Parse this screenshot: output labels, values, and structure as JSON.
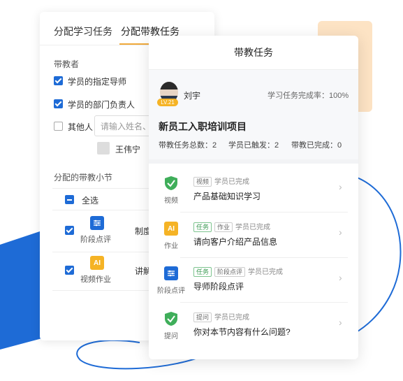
{
  "back_panel": {
    "tabs": [
      "分配学习任务",
      "分配带教任务"
    ],
    "mentor_section_label": "带教者",
    "options": [
      {
        "label": "学员的指定导师",
        "checked": true
      },
      {
        "label": "学员的部门负责人",
        "checked": true
      },
      {
        "label": "其他人",
        "checked": false
      }
    ],
    "name_input_placeholder": "请输入姓名、",
    "selected_person": "王伟宁",
    "sections_label": "分配的带教小节",
    "select_all_label": "全选",
    "rows": [
      {
        "icon_label": "阶段点评",
        "title": "制度"
      },
      {
        "icon_label": "视频作业",
        "title": "讲解"
      }
    ]
  },
  "task_card": {
    "title": "带教任务",
    "user": {
      "name": "刘宇",
      "level": "LV.21",
      "completion_label": "学习任务完成率：100%"
    },
    "project_title": "新员工入职培训项目",
    "stats": [
      "带教任务总数：2",
      "学员已触发：2",
      "带教已完成：0"
    ],
    "items": [
      {
        "icon": "shield-check-icon",
        "icon_label": "视频",
        "tags": [
          {
            "text": "视频",
            "style": "gray"
          }
        ],
        "status": "学员已完成",
        "title": "产品基础知识学习"
      },
      {
        "icon": "ai-icon",
        "icon_label": "作业",
        "tags": [
          {
            "text": "任务",
            "style": "green"
          },
          {
            "text": "作业",
            "style": "gray"
          }
        ],
        "status": "学员已完成",
        "title": "请向客户介绍产品信息"
      },
      {
        "icon": "sliders-icon",
        "icon_label": "阶段点评",
        "tags": [
          {
            "text": "任务",
            "style": "green"
          },
          {
            "text": "阶段点评",
            "style": "gray"
          }
        ],
        "status": "学员已完成",
        "title": "导师阶段点评"
      },
      {
        "icon": "shield-check-icon",
        "icon_label": "提问",
        "tags": [
          {
            "text": "提问",
            "style": "gray"
          }
        ],
        "status": "学员已完成",
        "title": "你对本节内容有什么问题?"
      }
    ],
    "ai_glyph": "AI"
  },
  "colors": {
    "accent_blue": "#1e6bd6",
    "accent_orange": "#f0a93a",
    "success_green": "#3fae5a"
  }
}
